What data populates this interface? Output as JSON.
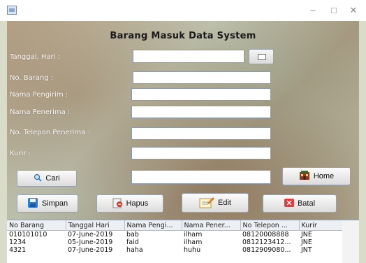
{
  "window": {
    "title": ""
  },
  "form": {
    "heading": "Barang Masuk Data System",
    "labels": {
      "tanggal": "Tanggal, Hari   :",
      "no_barang": "No. Barang      :",
      "pengirim": "Nama Pengirim :",
      "penerima": "Nama Penerima :",
      "telepon": "No. Telepon Penerima  :",
      "kurir": "Kurir  :"
    },
    "values": {
      "tanggal": "",
      "no_barang": "",
      "pengirim": "",
      "penerima": "",
      "telepon": "",
      "kurir": "",
      "cari": ""
    }
  },
  "buttons": {
    "cari": "Cari",
    "home": "Home",
    "simpan": "Simpan",
    "hapus": "Hapus",
    "edit": "Edit",
    "batal": "Batal"
  },
  "table": {
    "columns": [
      "No Barang",
      "Tanggal Hari",
      "Nama Pengi...",
      "Nama Pener...",
      "No Telepon ...",
      "Kurir"
    ],
    "rows": [
      [
        "010101010",
        "07-June-2019",
        "bab",
        "ilham",
        "08120008888",
        "JNE"
      ],
      [
        "1234",
        "05-June-2019",
        "faid",
        "ilham",
        "0812123412...",
        "JNE"
      ],
      [
        "4321",
        "07-June-2019",
        "haha",
        "huhu",
        "0812909080...",
        "JNT"
      ]
    ]
  },
  "colors": {
    "accent": "#2a6fb8",
    "batal": "#e23b3b",
    "field_border": "#8e9aa8"
  }
}
